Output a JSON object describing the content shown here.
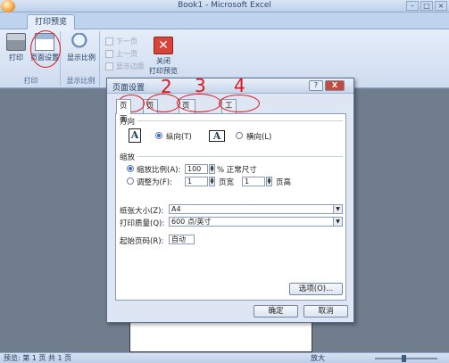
{
  "window": {
    "title": "Book1 - Microsoft Excel"
  },
  "ribbon": {
    "active_tab": "打印预览",
    "groups": {
      "print": {
        "label": "打印",
        "print_button": "打印",
        "page_setup_button": "页面设置"
      },
      "zoom": {
        "label": "显示比例",
        "zoom_button": "显示比例"
      },
      "preview": {
        "next_page": "下一页",
        "prev_page": "上一页",
        "show_margins": "显示边距",
        "close_line1": "关闭",
        "close_line2": "打印预览"
      }
    }
  },
  "dialog": {
    "title": "页面设置",
    "help_label": "?",
    "close_label": "X",
    "tabs": [
      "页面",
      "页边距",
      "页眉/页脚",
      "工作表"
    ],
    "orientation": {
      "heading": "方向",
      "icon_letter": "A",
      "portrait_label": "纵向(T)",
      "landscape_label": "横向(L)",
      "selected": "portrait"
    },
    "scaling": {
      "heading": "缩放",
      "adjust_label": "缩放比例(A):",
      "adjust_value": "100",
      "adjust_suffix": "% 正常尺寸",
      "fit_label": "调整为(F):",
      "fit_wide_value": "1",
      "fit_wide_suffix": "页宽",
      "fit_tall_value": "1",
      "fit_tall_suffix": "页高",
      "selected": "adjust"
    },
    "paper_size_label": "纸张大小(Z):",
    "paper_size_value": "A4",
    "print_quality_label": "打印质量(Q):",
    "print_quality_value": "600 点/英寸",
    "first_page_label": "起始页码(R):",
    "first_page_value": "自动",
    "options_button": "选项(O)...",
    "ok_button": "确定",
    "cancel_button": "取消"
  },
  "status": {
    "page_info": "预览: 第 1 页 共 1 页",
    "zoom_label": "放大"
  },
  "annotations": {
    "numbers": [
      "2",
      "3",
      "4"
    ],
    "color": "#e0141b"
  }
}
